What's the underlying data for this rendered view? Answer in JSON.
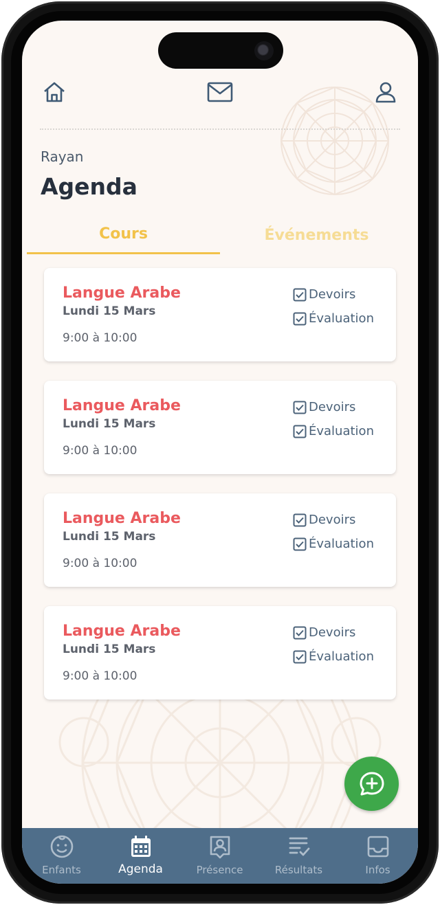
{
  "header": {
    "home_icon": "home-icon",
    "mail_icon": "mail-icon",
    "profile_icon": "user-icon"
  },
  "student_name": "Rayan",
  "page_title": "Agenda",
  "tabs": [
    {
      "label": "Cours",
      "active": true
    },
    {
      "label": "Événements",
      "active": false
    }
  ],
  "courses": [
    {
      "title": "Langue Arabe",
      "date": "Lundi 15 Mars",
      "time": "9:00 à 10:00",
      "homework_label": "Devoirs",
      "homework_checked": true,
      "evaluation_label": "Évaluation",
      "evaluation_checked": true
    },
    {
      "title": "Langue Arabe",
      "date": "Lundi 15 Mars",
      "time": "9:00 à 10:00",
      "homework_label": "Devoirs",
      "homework_checked": true,
      "evaluation_label": "Évaluation",
      "evaluation_checked": true
    },
    {
      "title": "Langue Arabe",
      "date": "Lundi 15 Mars",
      "time": "9:00 à 10:00",
      "homework_label": "Devoirs",
      "homework_checked": true,
      "evaluation_label": "Évaluation",
      "evaluation_checked": true
    },
    {
      "title": "Langue Arabe",
      "date": "Lundi 15 Mars",
      "time": "9:00 à 10:00",
      "homework_label": "Devoirs",
      "homework_checked": true,
      "evaluation_label": "Évaluation",
      "evaluation_checked": true
    }
  ],
  "fab_icon": "chat-add-icon",
  "bottom_nav": [
    {
      "label": "Enfants",
      "icon": "child-face-icon",
      "active": false
    },
    {
      "label": "Agenda",
      "icon": "calendar-icon",
      "active": true
    },
    {
      "label": "Présence",
      "icon": "attendance-icon",
      "active": false
    },
    {
      "label": "Résultats",
      "icon": "results-icon",
      "active": false
    },
    {
      "label": "Infos",
      "icon": "inbox-icon",
      "active": false
    }
  ],
  "colors": {
    "accent_yellow": "#f2c24a",
    "course_red": "#ea5a5e",
    "nav_blue": "#4f6e8a",
    "fab_green": "#3ea84a",
    "icon_blue": "#3f5a75"
  }
}
